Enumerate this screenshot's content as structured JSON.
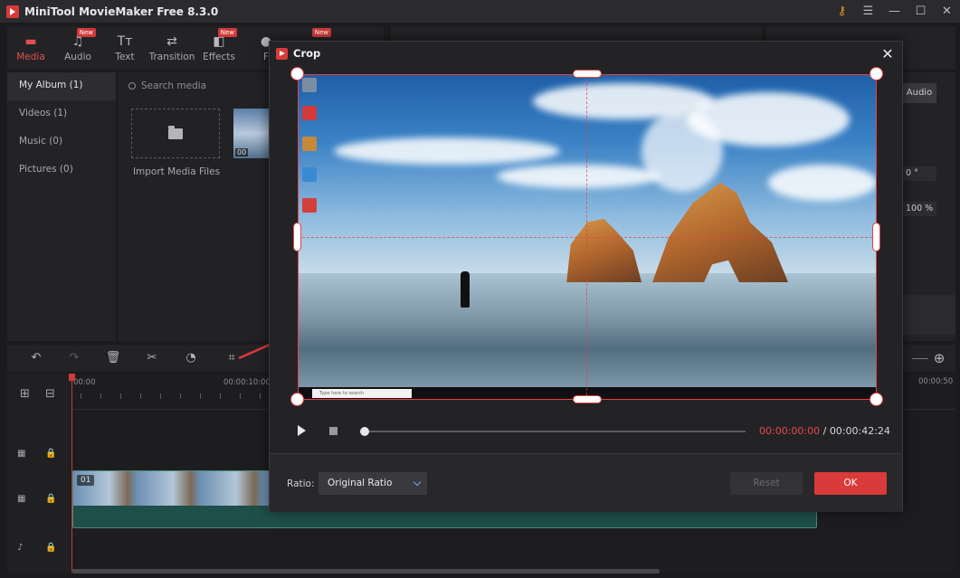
{
  "app": {
    "title": "MiniTool MovieMaker Free 8.3.0"
  },
  "toolbar": {
    "tabs": [
      {
        "label": "Media",
        "icon": "folder-icon"
      },
      {
        "label": "Audio",
        "icon": "music-note-icon",
        "badge": "New"
      },
      {
        "label": "Text",
        "icon": "text-icon"
      },
      {
        "label": "Transition",
        "icon": "transition-icon"
      },
      {
        "label": "Effects",
        "icon": "effects-icon",
        "badge": "New"
      }
    ],
    "partial_tab": "F",
    "partial_badge": "New"
  },
  "sidebar": {
    "items": [
      {
        "label": "My Album  (1)"
      },
      {
        "label": "Videos  (1)"
      },
      {
        "label": "Music  (0)"
      },
      {
        "label": "Pictures  (0)"
      }
    ]
  },
  "media": {
    "search_placeholder": "Search media",
    "import_label": "Import Media Files",
    "thumb_duration": "00"
  },
  "properties": {
    "audio_tab": "Audio",
    "rotation": "0 °",
    "scale": "100 %"
  },
  "timeline": {
    "ruler_labels": [
      "00:00",
      "00:00:10:00",
      "00:00:50"
    ],
    "clip_index": "01"
  },
  "crop_dialog": {
    "title": "Crop",
    "time_current": "00:00:00:00",
    "time_separator": " / ",
    "time_total": "00:00:42:24",
    "ratio_label": "Ratio:",
    "ratio_value": "Original Ratio",
    "reset_label": "Reset",
    "ok_label": "OK",
    "taskbar_search": "Type here to search"
  },
  "colors": {
    "accent": "#d93a3a",
    "crop_border": "#e74040",
    "timecode_current": "#e54a4a"
  }
}
